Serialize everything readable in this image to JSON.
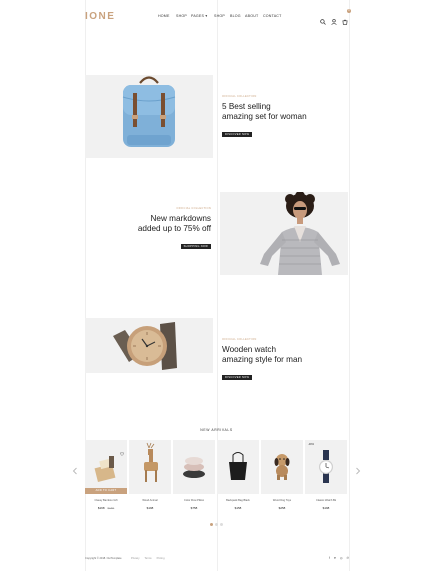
{
  "colors": {
    "accent": "#c9a27e",
    "dark": "#222222",
    "panel": "#f1f1f1"
  },
  "header": {
    "logo": "IONE",
    "nav": [
      {
        "label": "HOME"
      },
      {
        "label": "SHOP"
      },
      {
        "label": "PAGES ▾"
      },
      {
        "label": "SHOP"
      },
      {
        "label": "BLOG"
      },
      {
        "label": "ABOUT"
      },
      {
        "label": "CONTACT"
      }
    ],
    "icons": [
      "search-icon",
      "user-icon",
      "cart-icon"
    ],
    "cart_count": "0"
  },
  "features": [
    {
      "tag": "OFFICIAL COLLECTION",
      "title_line1": "5 Best selling",
      "title_line2": "amazing set for woman",
      "button": "DISCOVER NOW"
    },
    {
      "tag": "OFFICIAL COLLECTION",
      "title_line1": "New markdowns",
      "title_line2": "added up to 75% off",
      "button": "SHOPPING NOW"
    },
    {
      "tag": "OFFICIAL COLLECTION",
      "title_line1": "Wooden watch",
      "title_line2": "amazing style for man",
      "button": "DISCOVER NOW"
    }
  ],
  "new_arrivals": {
    "title": "NEW ARRIVALS",
    "add_to_cart": "ADD TO CART",
    "products": [
      {
        "name": "Classy Bamboo Gift",
        "price": "$198",
        "old_price": "$160",
        "badge": ""
      },
      {
        "name": "Wood Animal",
        "price": "$198",
        "old_price": "",
        "badge": ""
      },
      {
        "name": "Color Flow Pillow",
        "price": "$758",
        "old_price": "",
        "badge": ""
      },
      {
        "name": "Backpack Bag Black",
        "price": "$158",
        "old_price": "",
        "badge": ""
      },
      {
        "name": "Wood Dog Toys",
        "price": "$258",
        "old_price": "",
        "badge": ""
      },
      {
        "name": "Classic Watch Bk",
        "price": "$198",
        "old_price": "",
        "badge": "-30%"
      }
    ]
  },
  "footer": {
    "copyright": "Copyright © 2018. OurTemplate",
    "links": [
      "Privacy",
      "Terms",
      "Pricing"
    ],
    "social": [
      "facebook-icon",
      "twitter-icon",
      "instagram-icon",
      "pinterest-icon"
    ]
  }
}
